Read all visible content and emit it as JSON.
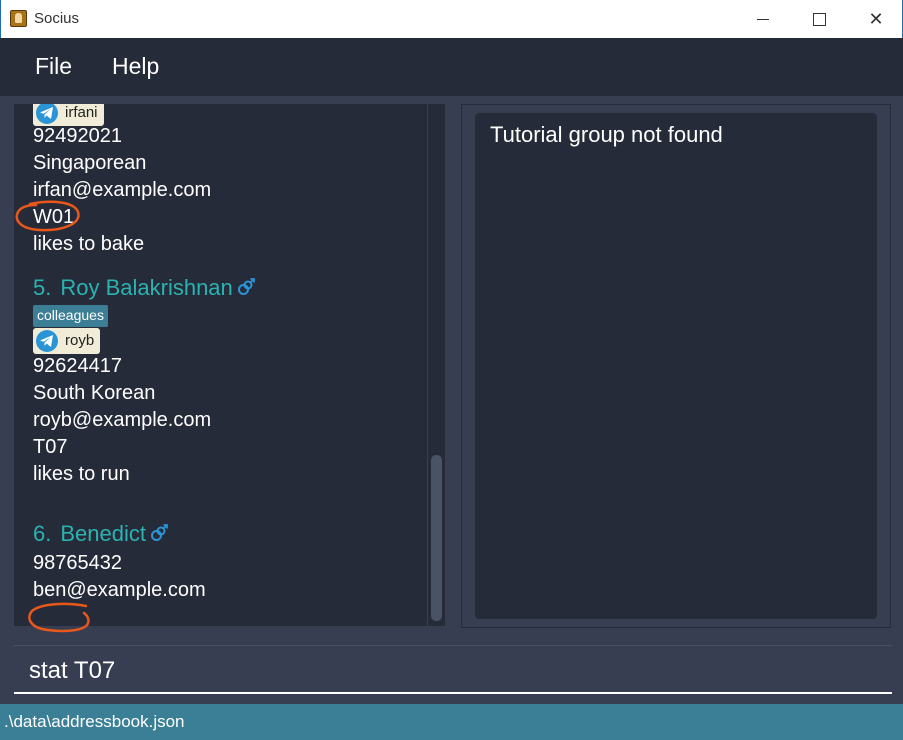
{
  "window": {
    "title": "Socius",
    "min_icon": "minimize-icon",
    "max_icon": "maximize-icon",
    "close_icon": "close-icon",
    "close_glyph": "✕"
  },
  "menu": {
    "file": "File",
    "help": "Help"
  },
  "persons": [
    {
      "telegram": "irfani",
      "phone": "92492021",
      "nationality": "Singaporean",
      "email": "irfan@example.com",
      "tutorial": "W01",
      "remark": "likes to bake"
    },
    {
      "index": "5.",
      "name": "Roy Balakrishnan",
      "tag": "colleagues",
      "telegram": "royb",
      "phone": "92624417",
      "nationality": "South Korean",
      "email": "royb@example.com",
      "tutorial": "T07",
      "remark": "likes to run"
    },
    {
      "index": "6.",
      "name": "Benedict",
      "phone": "98765432",
      "email": "ben@example.com"
    }
  ],
  "result": {
    "message": "Tutorial group not found"
  },
  "command": {
    "value": "stat T07"
  },
  "status": {
    "path": ".\\data\\addressbook.json"
  },
  "colors": {
    "accent": "#2ab3b0",
    "annotation": "#e8581a",
    "status_bar": "#3a7f96",
    "panel": "#262b3a"
  },
  "icons": {
    "telegram": "telegram-icon",
    "gender": "gender-icon"
  }
}
